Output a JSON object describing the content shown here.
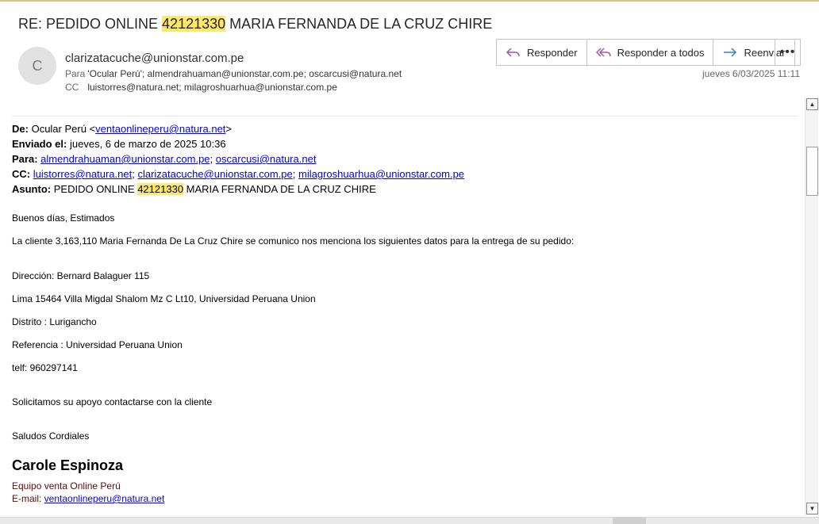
{
  "header": {
    "subject_prefix": "RE: PEDIDO ONLINE ",
    "subject_highlight": "42121330",
    "subject_suffix": " MARIA FERNANDA DE LA CRUZ CHIRE",
    "avatar_initial": "C",
    "from": "clarizatacuche@unionstar.com.pe",
    "to_label": "Para",
    "to_value": "'Ocular Perú'; almendrahuaman@unionstar.com.pe; oscarcusi@natura.net",
    "cc_label": "CC",
    "cc_value": "luistorres@natura.net; milagroshuarhua@unionstar.com.pe",
    "date": "jueves 6/03/2025 11:11"
  },
  "toolbar": {
    "reply": "Responder",
    "reply_all": "Responder a todos",
    "forward": "Reenviar",
    "more": "•••"
  },
  "quoted": {
    "de_label": "De:",
    "de_name": "Ocular Perú <",
    "de_email": "ventaonlineperu@natura.net",
    "de_end": ">",
    "enviado_label": "Enviado el:",
    "enviado_value": "jueves, 6 de marzo de 2025 10:36",
    "para_label": "Para:",
    "para_1": "almendrahuaman@unionstar.com.pe",
    "para_sep": "; ",
    "para_2": "oscarcusi@natura.net",
    "cc_label": "CC:",
    "cc_1": "luistorres@natura.net",
    "cc_2": "clarizatacuche@unionstar.com.pe",
    "cc_3": "milagroshuarhua@unionstar.com.pe",
    "asunto_label": "Asunto:",
    "asunto_prefix": "PEDIDO ONLINE ",
    "asunto_highlight": "42121330",
    "asunto_suffix": " MARIA FERNANDA DE LA CRUZ CHIRE"
  },
  "message": {
    "greeting": "Buenos días, Estimados",
    "intro": "La cliente 3,163,110 Maria Fernanda De La Cruz Chire  se comunico nos menciona los siguientes datos para la entrega de su pedido:",
    "direccion": "Dirección: Bernard Balaguer  115",
    "lima": "Lima 15464 Villa Migdal Shalom Mz C Lt10, Universidad Peruana Union",
    "distrito": "Distrito :  Lurigancho",
    "referencia": "Referencia : Universidad Peruana Union",
    "telf": "telf: 960297141",
    "solicitud": "Solicitamos su apoyo contactarse con la cliente",
    "saludos": "Saludos Cordiales"
  },
  "signature": {
    "name": "Carole Espinoza",
    "team": "Equipo venta Online Perú",
    "email_label": "E-mail: ",
    "email": "ventaonlineperu@natura.net"
  },
  "scrollbar": {
    "up": "▲",
    "down": "▼"
  },
  "colors": {
    "highlight": "#fde86b",
    "link": "#0000ee",
    "accent_icon": "#a855a8"
  }
}
